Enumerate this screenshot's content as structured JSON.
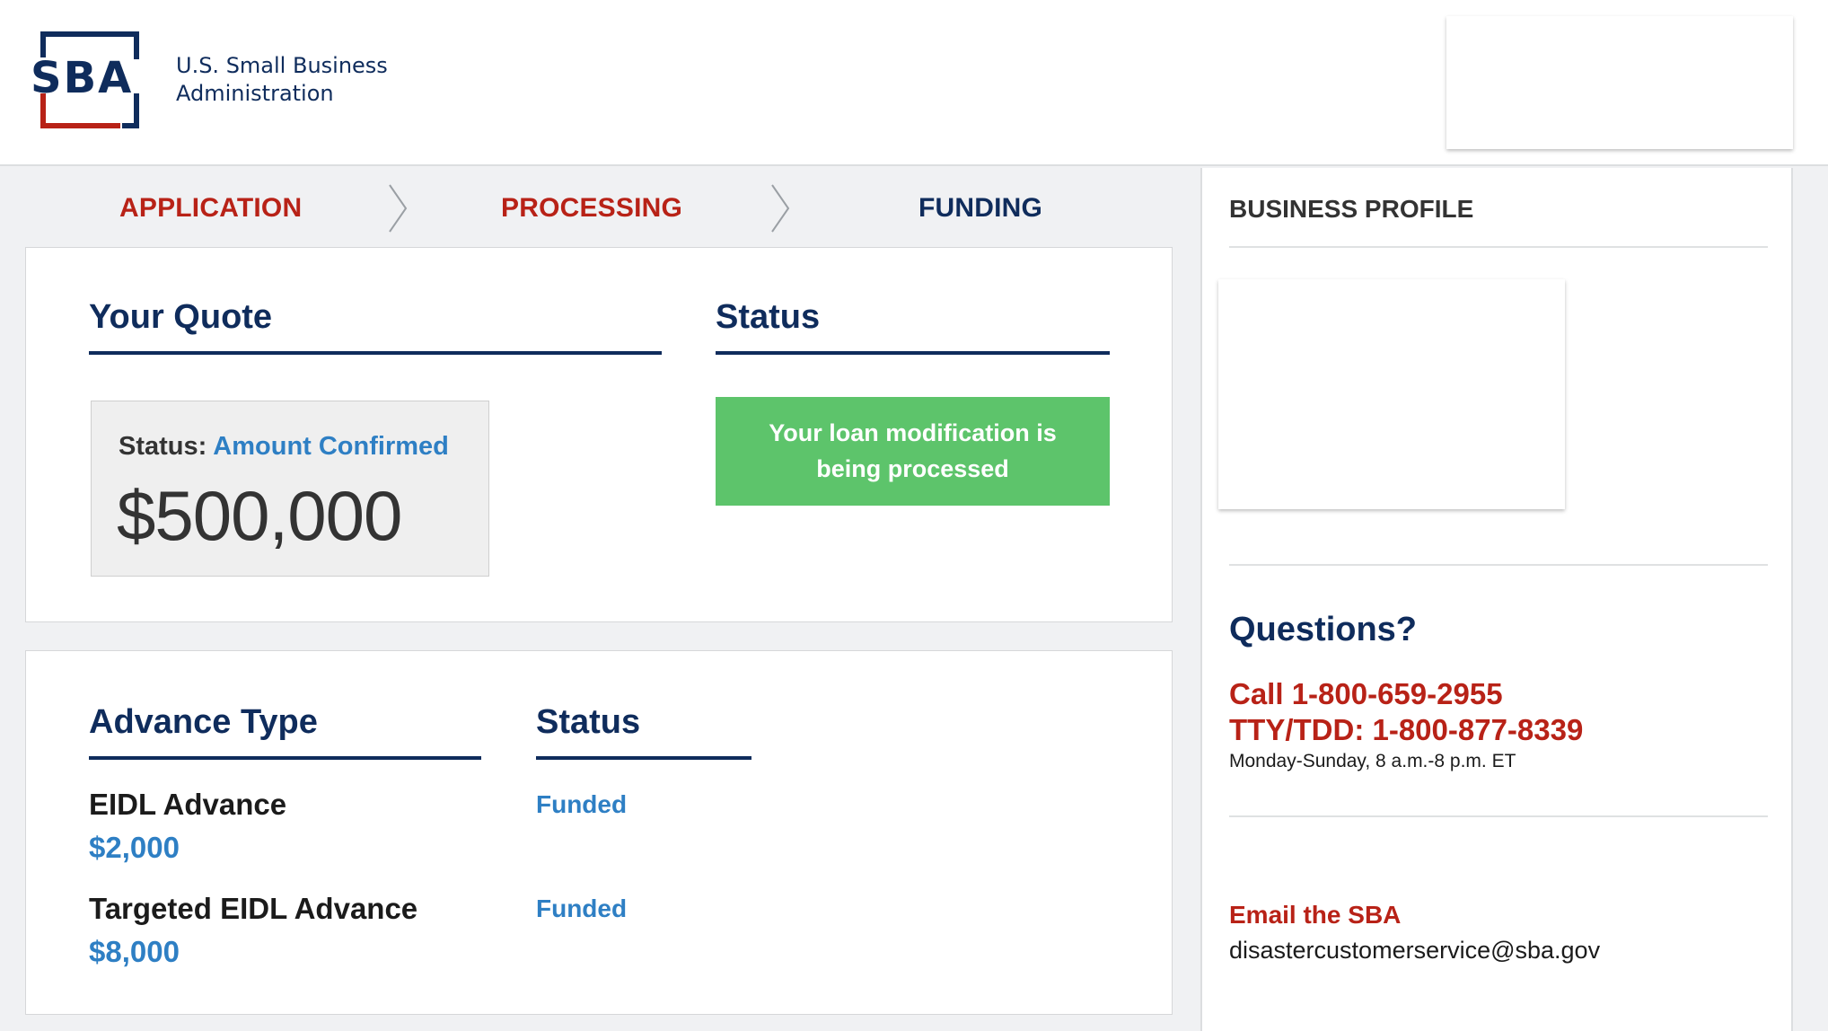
{
  "header": {
    "logo_letters": "SBA",
    "org_name_line1": "U.S. Small Business",
    "org_name_line2": "Administration"
  },
  "steps": [
    {
      "label": "APPLICATION",
      "state": "done"
    },
    {
      "label": "PROCESSING",
      "state": "done"
    },
    {
      "label": "FUNDING",
      "state": "current"
    }
  ],
  "quote": {
    "heading": "Your Quote",
    "status_label": "Status:",
    "status_value": "Amount Confirmed",
    "amount": "$500,000"
  },
  "status_section": {
    "heading": "Status",
    "banner_line1": "Your loan modification is",
    "banner_line2": "being processed"
  },
  "advances": {
    "type_heading": "Advance Type",
    "status_heading": "Status",
    "items": [
      {
        "name": "EIDL Advance",
        "amount": "$2,000",
        "status": "Funded"
      },
      {
        "name": "Targeted EIDL Advance",
        "amount": "$8,000",
        "status": "Funded"
      }
    ]
  },
  "sidebar": {
    "profile_heading": "BUSINESS PROFILE",
    "questions_heading": "Questions?",
    "call_line": "Call 1-800-659-2955",
    "tty_line": "TTY/TDD: 1-800-877-8339",
    "hours": "Monday-Sunday, 8 a.m.-8 p.m. ET",
    "email_label": "Email the SBA",
    "email": "disastercustomerservice@sba.gov"
  },
  "colors": {
    "navy": "#0f2c5c",
    "red": "#b82217",
    "link_blue": "#2e7fc4",
    "success_green": "#5dc46b"
  }
}
